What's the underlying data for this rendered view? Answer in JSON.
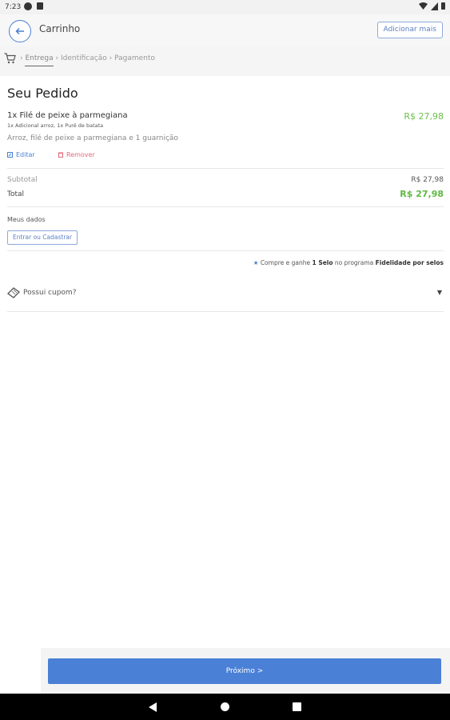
{
  "status_bar": {
    "time": "7:23"
  },
  "header": {
    "title": "Carrinho",
    "add_more": "Adicionar mais"
  },
  "steps": {
    "s1": "Entrega",
    "s2": "Identificação",
    "s3": "Pagamento"
  },
  "order": {
    "heading": "Seu Pedido",
    "item": {
      "name": "1x Filé de peixe à parmegiana",
      "addons": "1x Adicional arroz, 1x Purê de batata",
      "description": "Arroz, filé de peixe a parmegiana e 1 guarnição",
      "price": "R$ 27,98",
      "edit": "Editar",
      "remove": "Remover"
    },
    "subtotal_label": "Subtotal",
    "subtotal_value": "R$ 27,98",
    "total_label": "Total",
    "total_value": "R$ 27,98"
  },
  "my_data": {
    "label": "Meus dados",
    "login_button": "Entrar ou Cadastrar"
  },
  "loyalty": {
    "p1": "Compre e ganhe ",
    "b1": "1 Selo",
    "p2": " no programa ",
    "b2": "Fidelidade por selos"
  },
  "coupon": {
    "label": "Possui cupom?"
  },
  "footer": {
    "next_button": "Próximo >"
  },
  "colors": {
    "accent": "#4a80d6",
    "price": "#6bbf4a",
    "remove": "#e46a7a"
  }
}
